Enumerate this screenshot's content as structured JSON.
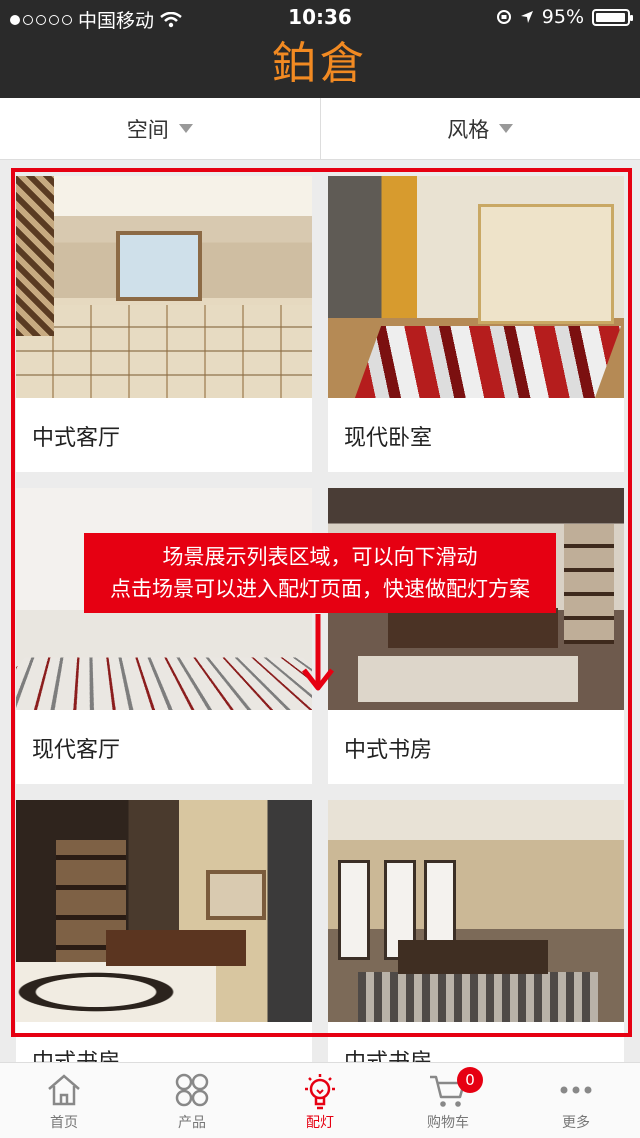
{
  "status_bar": {
    "carrier": "中国移动",
    "time": "10:36",
    "battery": "95%",
    "battery_level": 0.95
  },
  "header": {
    "logo_text": "鉑倉",
    "accent_color": "#f28a22"
  },
  "filters": [
    {
      "label": "空间"
    },
    {
      "label": "风格"
    }
  ],
  "scenes": [
    {
      "name": "中式客厅"
    },
    {
      "name": "现代卧室"
    },
    {
      "name": "现代客厅"
    },
    {
      "name": "中式书房"
    },
    {
      "name": "中式书房"
    },
    {
      "name": "中式书房"
    }
  ],
  "annotation": {
    "line1": "场景展示列表区域，可以向下滑动",
    "line2": "点击场景可以进入配灯页面，快速做配灯方案",
    "color": "#e60012"
  },
  "tabbar": {
    "items": [
      {
        "label": "首页",
        "icon": "home-icon"
      },
      {
        "label": "产品",
        "icon": "grid-icon"
      },
      {
        "label": "配灯",
        "icon": "bulb-icon"
      },
      {
        "label": "购物车",
        "icon": "cart-icon",
        "badge": "0"
      },
      {
        "label": "更多",
        "icon": "more-icon"
      }
    ],
    "active_index": 2
  }
}
